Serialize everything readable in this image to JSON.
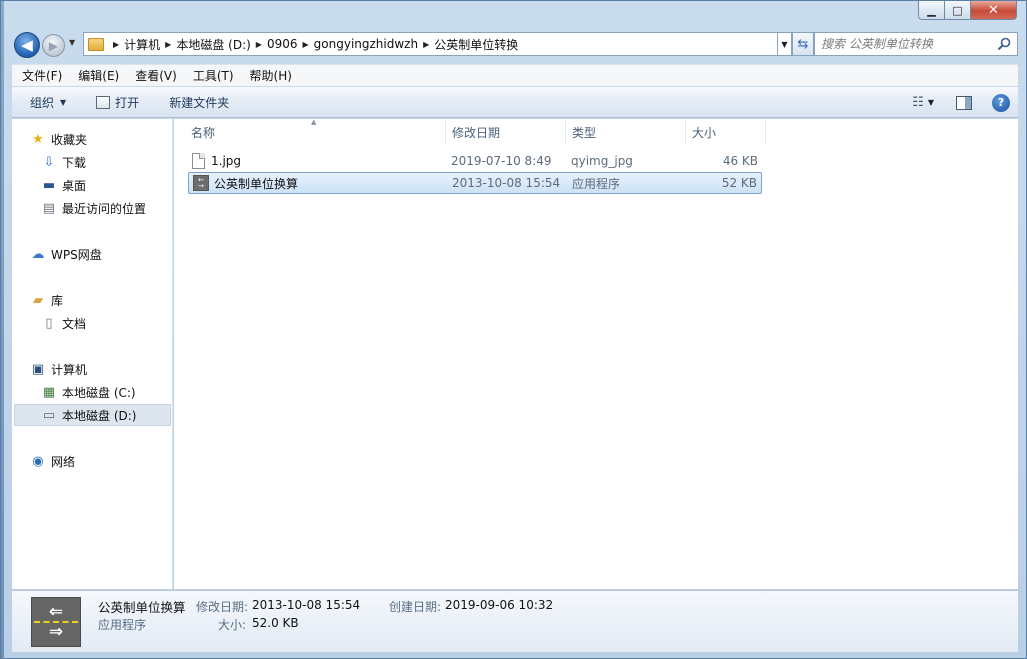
{
  "window": {
    "caption": {
      "minimize": "▁",
      "maximize": "□",
      "close": "✕"
    }
  },
  "nav": {
    "back_glyph": "◀",
    "forward_glyph": "▶"
  },
  "address": {
    "crumbs": [
      "计算机",
      "本地磁盘 (D:)",
      "0906",
      "gongyingzhidwzh",
      "公英制单位转换"
    ]
  },
  "search": {
    "placeholder": "搜索 公英制单位转换"
  },
  "menu": [
    "文件(F)",
    "编辑(E)",
    "查看(V)",
    "工具(T)",
    "帮助(H)"
  ],
  "toolbar": {
    "organize": "组织",
    "open": "打开",
    "new_folder": "新建文件夹"
  },
  "sidebar": {
    "favorites": "收藏夹",
    "downloads": "下载",
    "desktop": "桌面",
    "recent": "最近访问的位置",
    "wps": "WPS网盘",
    "libraries": "库",
    "documents": "文档",
    "computer": "计算机",
    "drive_c": "本地磁盘 (C:)",
    "drive_d": "本地磁盘 (D:)",
    "network": "网络"
  },
  "columns": {
    "name": "名称",
    "date": "修改日期",
    "type": "类型",
    "size": "大小"
  },
  "files": [
    {
      "name": "1.jpg",
      "date": "2019-07-10 8:49",
      "type": "qyimg_jpg",
      "size": "46 KB"
    },
    {
      "name": "公英制单位换算",
      "date": "2013-10-08 15:54",
      "type": "应用程序",
      "size": "52 KB"
    }
  ],
  "details": {
    "name": "公英制单位换算",
    "type": "应用程序",
    "modified_label": "修改日期:",
    "modified_value": "2013-10-08 15:54",
    "created_label": "创建日期:",
    "created_value": "2019-09-06 10:32",
    "size_label": "大小:",
    "size_value": "52.0 KB"
  }
}
